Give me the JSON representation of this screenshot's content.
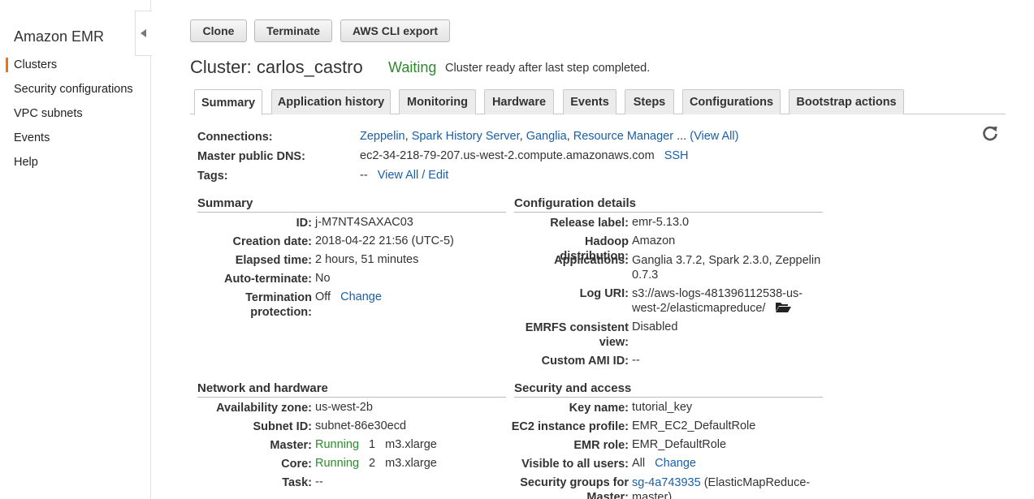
{
  "sidebar": {
    "brand": "Amazon EMR",
    "items": [
      {
        "label": "Clusters"
      },
      {
        "label": "Security configurations"
      },
      {
        "label": "VPC subnets"
      },
      {
        "label": "Events"
      },
      {
        "label": "Help"
      }
    ]
  },
  "toolbar": {
    "clone": "Clone",
    "terminate": "Terminate",
    "cli_export": "AWS CLI export"
  },
  "header": {
    "title": "Cluster: carlos_castro",
    "status": "Waiting",
    "status_desc": "Cluster ready after last step completed."
  },
  "tabs": [
    {
      "label": "Summary"
    },
    {
      "label": "Application history"
    },
    {
      "label": "Monitoring"
    },
    {
      "label": "Hardware"
    },
    {
      "label": "Events"
    },
    {
      "label": "Steps"
    },
    {
      "label": "Configurations"
    },
    {
      "label": "Bootstrap actions"
    }
  ],
  "overview": {
    "connections_label": "Connections:",
    "connections": [
      "Zeppelin",
      "Spark History Server",
      "Ganglia",
      "Resource Manager"
    ],
    "connections_more": "...",
    "view_all": "(View All)",
    "dns_label": "Master public DNS:",
    "dns_value": "ec2-34-218-79-207.us-west-2.compute.amazonaws.com",
    "ssh": "SSH",
    "tags_label": "Tags:",
    "tags_value": "--",
    "tags_link": "View All / Edit"
  },
  "summary": {
    "heading": "Summary",
    "id_label": "ID:",
    "id_value": "j-M7NT4SAXAC03",
    "creation_label": "Creation date:",
    "creation_value": "2018-04-22 21:56 (UTC-5)",
    "elapsed_label": "Elapsed time:",
    "elapsed_value": "2 hours, 51 minutes",
    "autoterm_label": "Auto-terminate:",
    "autoterm_value": "No",
    "termprot_label_1": "Termination",
    "termprot_label_2": "protection:",
    "termprot_value": "Off",
    "termprot_change": "Change"
  },
  "config": {
    "heading": "Configuration details",
    "release_label": "Release label:",
    "release_value": "emr-5.13.0",
    "hadoop_label": "Hadoop distribution:",
    "hadoop_value": "Amazon",
    "apps_label": "Applications:",
    "apps_value_1": "Ganglia 3.7.2, Spark 2.3.0, Zeppelin",
    "apps_value_2": "0.7.3",
    "log_label": "Log URI:",
    "log_value_1": "s3://aws-logs-481396112538-us-",
    "log_value_2": "west-2/elasticmapreduce/",
    "emrfs_label_1": "EMRFS consistent",
    "emrfs_label_2": "view:",
    "emrfs_value": "Disabled",
    "ami_label": "Custom AMI ID:",
    "ami_value": "--"
  },
  "network": {
    "heading": "Network and hardware",
    "az_label": "Availability zone:",
    "az_value": "us-west-2b",
    "subnet_label": "Subnet ID:",
    "subnet_value": "subnet-86e30ecd",
    "master_label": "Master:",
    "master_status": "Running",
    "master_count": "1",
    "master_type": "m3.xlarge",
    "core_label": "Core:",
    "core_status": "Running",
    "core_count": "2",
    "core_type": "m3.xlarge",
    "task_label": "Task:",
    "task_value": "--"
  },
  "security": {
    "heading": "Security and access",
    "key_label": "Key name:",
    "key_value": "tutorial_key",
    "profile_label": "EC2 instance profile:",
    "profile_value": "EMR_EC2_DefaultRole",
    "role_label": "EMR role:",
    "role_value": "EMR_DefaultRole",
    "visible_label": "Visible to all users:",
    "visible_value": "All",
    "visible_change": "Change",
    "sg_label_1": "Security groups for",
    "sg_label_2": "Master:",
    "sg_link": "sg-4a743935",
    "sg_value_1": "(ElasticMapReduce-",
    "sg_value_2": "master)"
  },
  "colors": {
    "link": "#1a5fa8",
    "running": "#2d8a2d",
    "active_marker": "#e47911"
  }
}
